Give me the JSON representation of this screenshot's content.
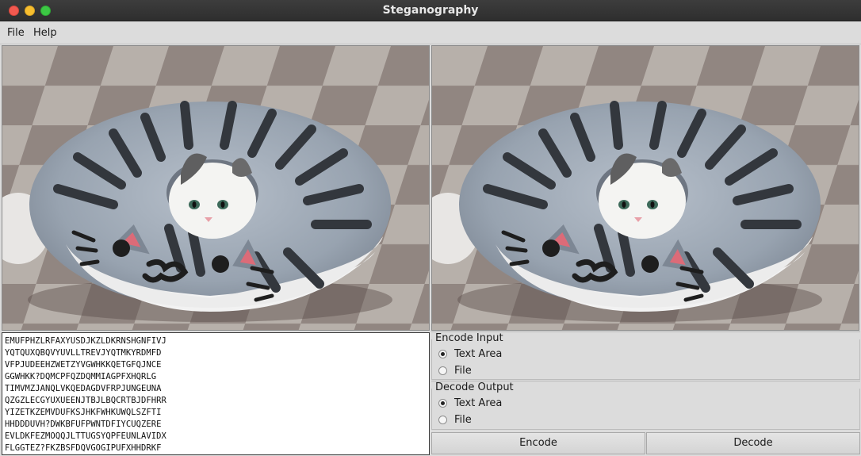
{
  "window": {
    "title": "Steganography"
  },
  "menu": {
    "file": "File",
    "help": "Help"
  },
  "images": {
    "left_alt": "cat in donut cushion (original)",
    "right_alt": "cat in donut cushion (encoded)"
  },
  "textarea": {
    "lines": [
      "EMUFPHZLRFAXYUSDJKZLDKRNSHGNFIVJ",
      "YQTQUXQBQVYUVLLTREVJYQTMKYRDMFD",
      "VFPJUDEEHZWETZYVGWHKKQETGFQJNCE",
      "GGWHKK?DQMCPFQZDQMMIAGPFXHQRLG",
      "TIMVMZJANQLVKQEDAGDVFRPJUNGEUNA",
      "QZGZLECGYUXUEENJTBJLBQCRTBJDFHRR",
      "YIZETKZEMVDUFKSJHKFWHKUWQLSZFTI",
      "HHDDDUVH?DWKBFUFPWNTDFIYCUQZERE",
      "EVLDKFEZMOQQJLTTUGSYQPFEUNLAVIDX",
      "FLGGTEZ?FKZBSFDQVGOGIPUFXHHDRKF"
    ]
  },
  "encode_input": {
    "label": "Encode Input",
    "options": [
      {
        "label": "Text Area",
        "checked": true
      },
      {
        "label": "File",
        "checked": false
      }
    ]
  },
  "decode_output": {
    "label": "Decode Output",
    "options": [
      {
        "label": "Text Area",
        "checked": true
      },
      {
        "label": "File",
        "checked": false
      }
    ]
  },
  "buttons": {
    "encode": "Encode",
    "decode": "Decode"
  }
}
